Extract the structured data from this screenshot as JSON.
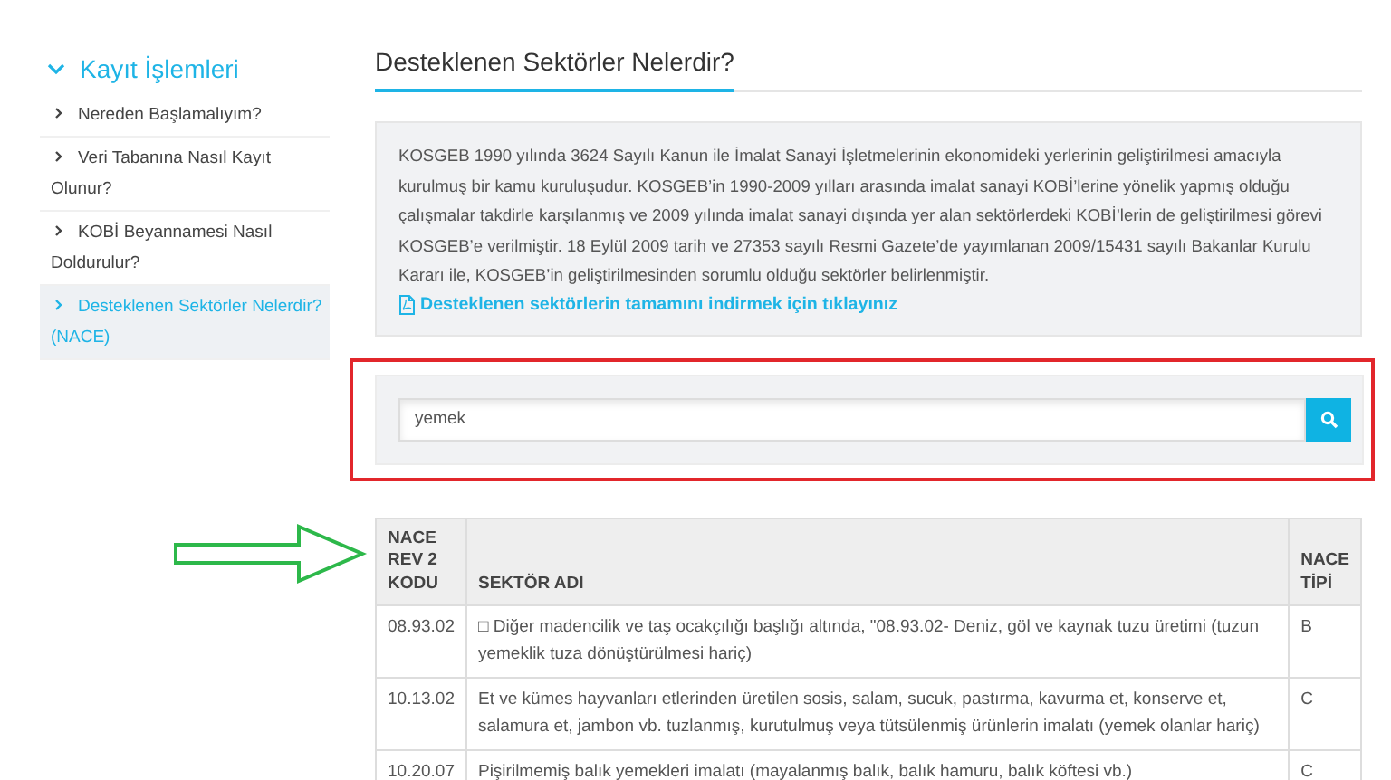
{
  "sidebar": {
    "title": "Kayıt İşlemleri",
    "expanded": true,
    "items": [
      {
        "label": "Nereden Başlamalıyım?",
        "selected": false
      },
      {
        "label": "Veri Tabanına Nasıl Kayıt Olunur?",
        "selected": false
      },
      {
        "label": "KOBİ Beyannamesi Nasıl Doldurulur?",
        "selected": false
      },
      {
        "label": "Desteklenen Sektörler Nelerdir? (NACE)",
        "selected": true
      }
    ]
  },
  "page_title": "Desteklenen Sektörler Nelerdir?",
  "info": {
    "text": "KOSGEB 1990 yılında 3624 Sayılı Kanun ile İmalat Sanayi İşletmelerinin ekonomideki yerlerinin geliştirilmesi amacıyla kurulmuş bir kamu kuruluşudur. KOSGEB’in 1990-2009 yılları arasında imalat sanayi KOBİ’lerine yönelik yapmış olduğu çalışmalar takdirle karşılanmış ve 2009 yılında imalat sanayi dışında yer alan sektörlerdeki KOBİ’lerin de geliştirilmesi görevi KOSGEB’e verilmiştir. 18 Eylül 2009 tarih ve 27353 sayılı Resmi Gazete’de yayımlanan 2009/15431 sayılı Bakanlar Kurulu Kararı ile, KOSGEB’in geliştirilmesinden sorumlu olduğu sektörler belirlenmiştir.",
    "link": "Desteklenen sektörlerin tamamını indirmek için tıklayınız"
  },
  "search": {
    "value": "yemek"
  },
  "table": {
    "columns": [
      "NACE REV 2 KODU",
      "SEKTÖR ADI",
      "NACE TİPİ"
    ],
    "rows": [
      [
        "08.93.02",
        "□ Diğer madencilik ve taş ocakçılığı başlığı altında, \"08.93.02- Deniz, göl ve kaynak tuzu üretimi (tuzun yemeklik tuza dönüştürülmesi hariç)",
        "B"
      ],
      [
        "10.13.02",
        "Et ve kümes hayvanları etlerinden üretilen sosis, salam, sucuk, pastırma, kavurma et, konserve et, salamura et, jambon vb. tuzlanmış, kurutulmuş veya tütsülenmiş ürünlerin imalatı (yemek olanlar hariç)",
        "C"
      ],
      [
        "10.20.07",
        "Pişirilmemiş balık yemekleri imalatı (mayalanmış balık, balık hamuru, balık köftesi vb.)",
        "C"
      ]
    ]
  }
}
